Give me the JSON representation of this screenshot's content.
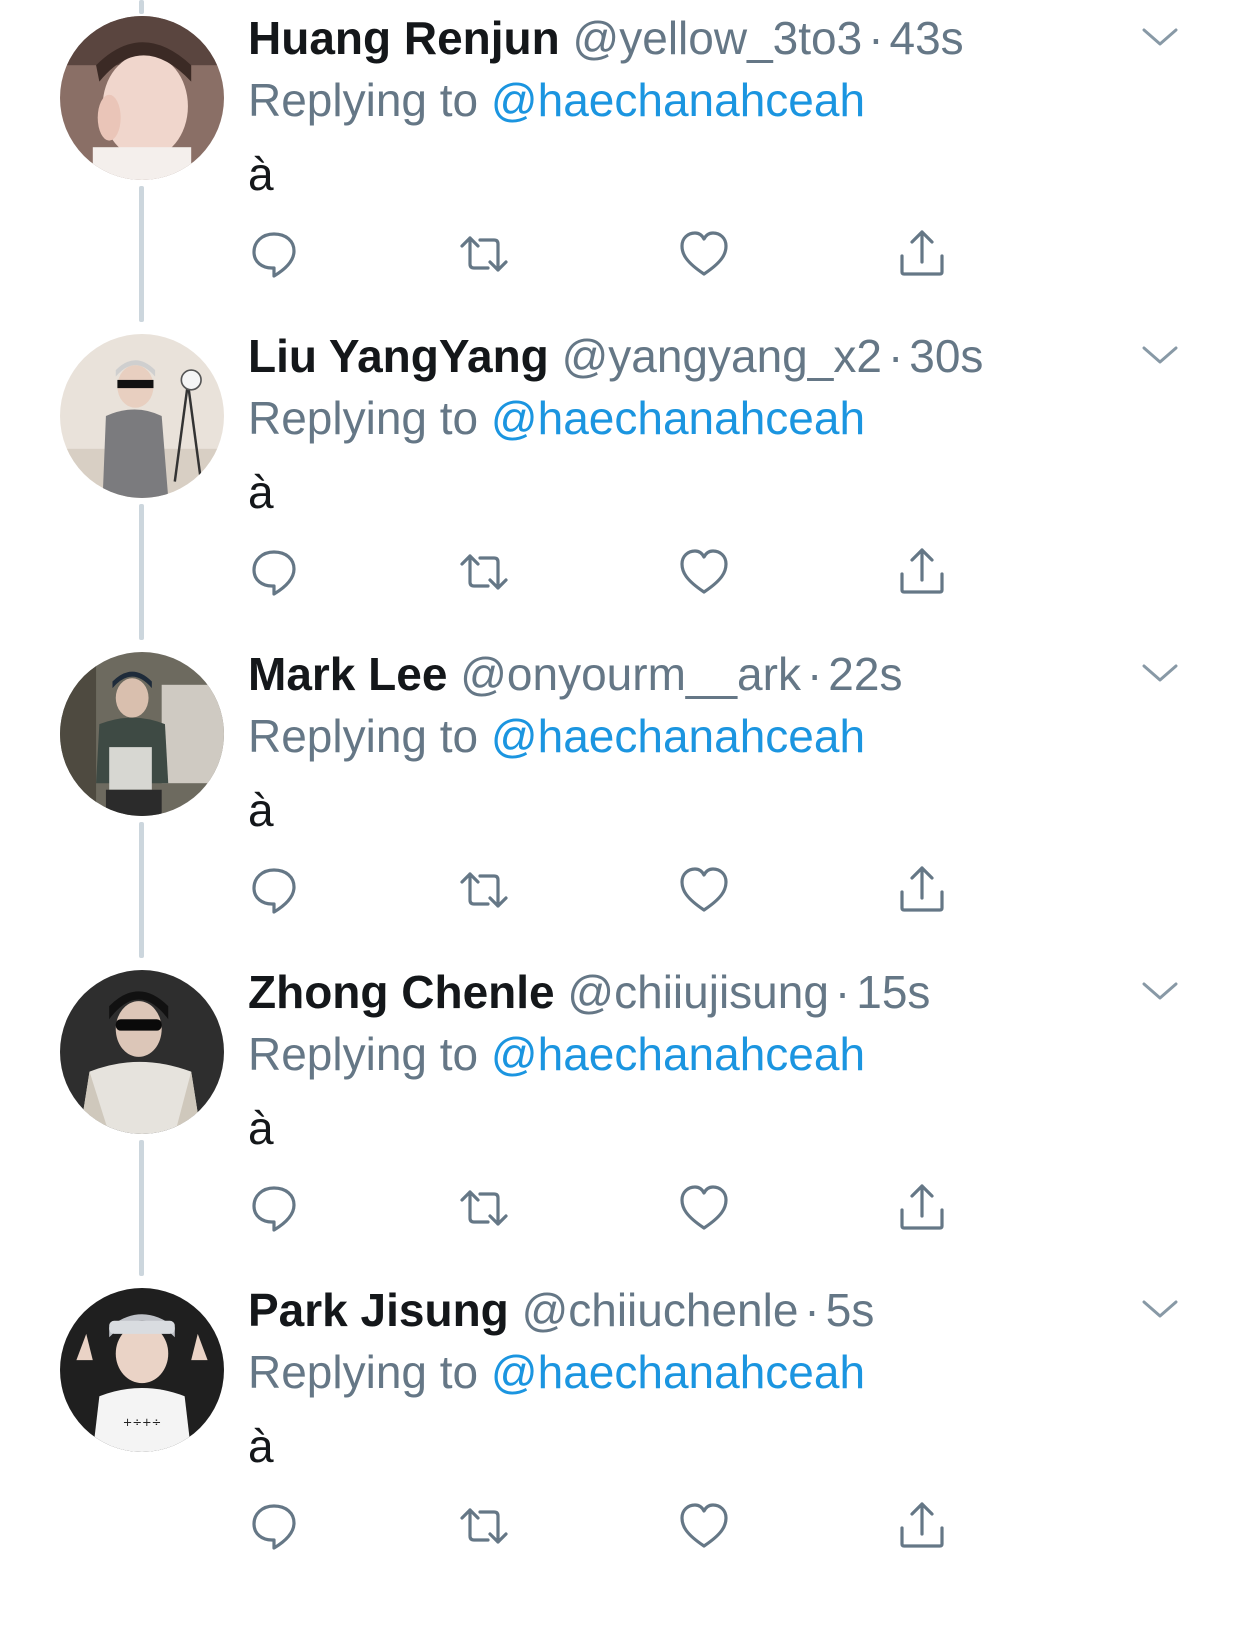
{
  "thread": {
    "reply_prefix": "Replying to",
    "icons": {
      "more": "chevron-down-icon",
      "reply": "reply-bubble-icon",
      "retweet": "retweet-icon",
      "like": "heart-icon",
      "share": "share-icon"
    },
    "colors": {
      "name": "#14171a",
      "meta": "#657786",
      "link": "#1b95e0",
      "thread_line": "#ccd6dd"
    },
    "tweets": [
      {
        "name": "Huang Renjun",
        "handle": "@yellow_3to3",
        "sep": "·",
        "time": "43s",
        "replying_to": "@haechanahceah",
        "text": "à"
      },
      {
        "name": "Liu YangYang",
        "handle": "@yangyang_x2",
        "sep": "·",
        "time": "30s",
        "replying_to": "@haechanahceah",
        "text": "à"
      },
      {
        "name": "Mark Lee",
        "handle": "@onyourm__ark",
        "sep": "·",
        "time": "22s",
        "replying_to": "@haechanahceah",
        "text": "à"
      },
      {
        "name": "Zhong Chenle",
        "handle": "@chiiujisung",
        "sep": "·",
        "time": "15s",
        "replying_to": "@haechanahceah",
        "text": "à"
      },
      {
        "name": "Park Jisung",
        "handle": "@chiiuchenle",
        "sep": "·",
        "time": "5s",
        "replying_to": "@haechanahceah",
        "text": "à"
      }
    ]
  }
}
